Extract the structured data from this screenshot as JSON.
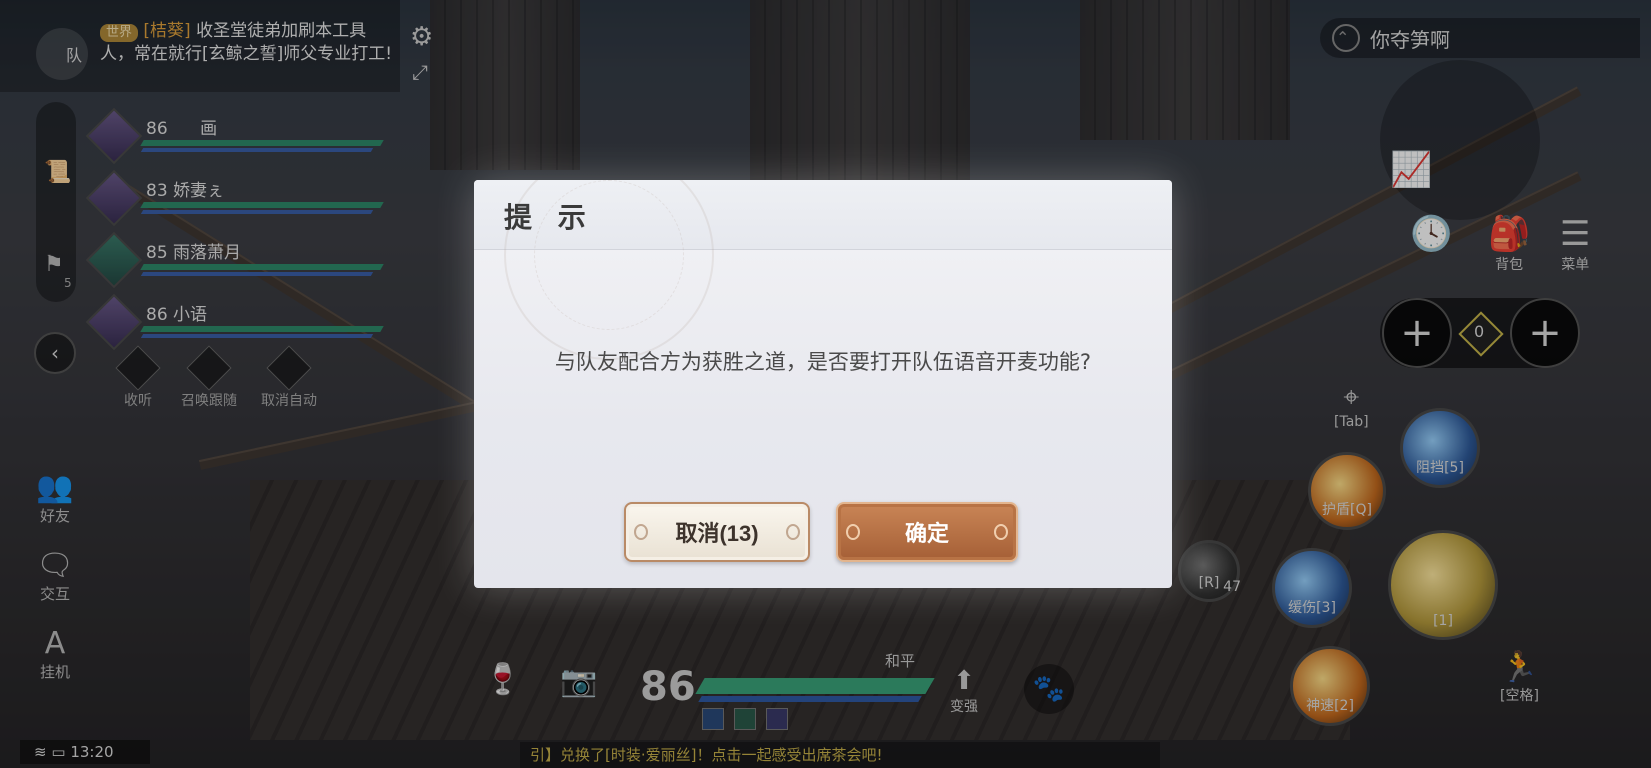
{
  "chat": {
    "channel": "世界",
    "sender": "[桔葵]",
    "message": "收圣堂徒弟加刷本工具人，常在就行[玄鲸之誓]师父专业打工!",
    "team_label": "队"
  },
  "team": [
    {
      "level": "86",
      "name": "画",
      "color": "purple"
    },
    {
      "level": "83",
      "name": "娇妻ぇ",
      "color": "purple"
    },
    {
      "level": "85",
      "name": "雨落萧月",
      "color": "green"
    },
    {
      "level": "86",
      "name": "小语",
      "color": "purple"
    }
  ],
  "team_side_count": "5",
  "voice_actions": [
    {
      "label": "收听",
      "icon": "headphones-icon"
    },
    {
      "label": "召唤跟随",
      "icon": "hand-icon"
    },
    {
      "label": "取消自动",
      "icon": "auto-icon"
    }
  ],
  "left_menu": [
    {
      "label": "好友",
      "icon": "friends-icon"
    },
    {
      "label": "交互",
      "icon": "interact-icon"
    },
    {
      "label": "挂机",
      "icon": "auto-battle-icon"
    }
  ],
  "top_right": {
    "player_name": "你夺笋啊",
    "bag_label": "背包",
    "menu_label": "菜单"
  },
  "skills": {
    "center_count": "0",
    "tab_label": "[Tab]",
    "block": "阻挡[5]",
    "shield": "护盾[Q]",
    "slow": "缓伤[3]",
    "main": "[1]",
    "speed": "神速[2]",
    "r_skill": "[R]",
    "r_count": "47",
    "space": "[空格]"
  },
  "bottom": {
    "player_level": "86",
    "mode": "和平",
    "strengthen": "变强",
    "ticker": "引】兑换了[时装·爱丽丝]！点击一起感受出席茶会吧!",
    "time": "13:20"
  },
  "dialog": {
    "title": "提 示",
    "message": "与队友配合方为获胜之道，是否要打开队伍语音开麦功能?",
    "cancel_label": "取消(13)",
    "confirm_label": "确定"
  }
}
